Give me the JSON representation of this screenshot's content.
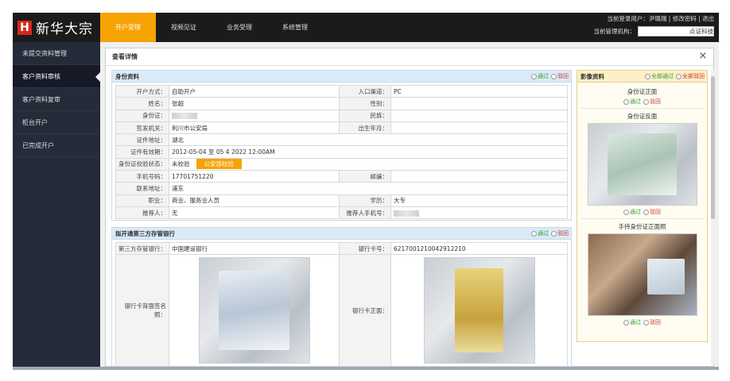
{
  "header": {
    "logo_mark": "H",
    "logo_text": "新华大宗",
    "nav": [
      "开户受理",
      "视频见证",
      "业务受理",
      "系统管理"
    ],
    "user_line": "当前登录用户：尹璐瑞 | 修改密码 | 退出",
    "org_label": "当前管理机构：",
    "org_value": "点证科技"
  },
  "sidebar": {
    "items": [
      "未提交资料管理",
      "客户资料审核",
      "客户资料复审",
      "柜台开户",
      "已完成开户"
    ],
    "active_index": 1
  },
  "detail": {
    "title": "查看详情",
    "close": "×"
  },
  "identity": {
    "title": "身份资料",
    "pass": "通过",
    "reject": "驳回",
    "rows": {
      "open_method_label": "开户方式：",
      "open_method": "自助开户",
      "channel_label": "入口渠道：",
      "channel": "PC",
      "name_label": "姓名：",
      "name": "张超",
      "gender_label": "性别：",
      "gender": "",
      "id_label": "身份证：",
      "ethnic_label": "民族：",
      "ethnic": "",
      "issuer_label": "签发机关：",
      "issuer": "利川市公安局",
      "birth_label": "出生年月：",
      "birth": "",
      "addr_label": "证件地址：",
      "addr": "湖北",
      "valid_label": "证件有效期：",
      "valid": "2012-05-04 至 05 4 2022 12:00AM",
      "verify_label": "身份证校验状态：",
      "verify": "未校验",
      "verify_btn": "公安部校验",
      "phone_label": "手机号码：",
      "phone": "17701751220",
      "email_label": "邮编：",
      "email": "",
      "contact_label": "联系地址：",
      "contact": "浦东",
      "job_label": "职业：",
      "job": "商业、服务业人员",
      "edu_label": "学历：",
      "edu": "大专",
      "ref_label": "推荐人：",
      "ref": "无",
      "ref_phone_label": "推荐人手机号："
    }
  },
  "bank": {
    "title": "拟开通第三方存管银行",
    "pass": "通过",
    "reject": "驳回",
    "bank_label": "第三方存管银行：",
    "bank_name": "中国建设银行",
    "card_label": "银行卡号：",
    "card_no": "6217001210042912210",
    "back_label": "银行卡背面签名照：",
    "front_label": "银行卡正面："
  },
  "images": {
    "title": "影像资料",
    "all_pass": "全部通过",
    "all_reject": "全部驳回",
    "pass": "通过",
    "reject": "驳回",
    "front_title": "身份证正面",
    "back_title": "身份证反面",
    "hold_title": "手持身份证正面照"
  }
}
